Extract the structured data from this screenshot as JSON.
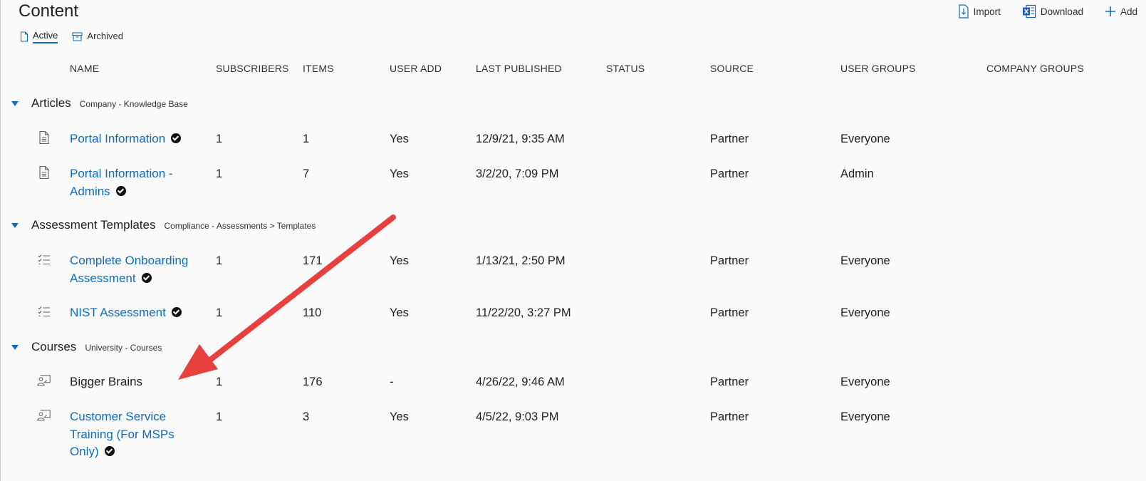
{
  "page": {
    "title": "Content",
    "tabs": [
      {
        "label": "Active",
        "icon": "document-icon",
        "active": true
      },
      {
        "label": "Archived",
        "icon": "archive-icon",
        "active": false
      }
    ],
    "toolbar": {
      "import_label": "Import",
      "download_label": "Download",
      "add_label": "Add"
    }
  },
  "columns": {
    "name": "NAME",
    "subscribers": "SUBSCRIBERS",
    "items": "ITEMS",
    "user_add": "USER ADD",
    "last_published": "LAST PUBLISHED",
    "status": "STATUS",
    "source": "SOURCE",
    "user_groups": "USER GROUPS",
    "company_groups": "COMPANY GROUPS"
  },
  "groups": [
    {
      "name": "Articles",
      "path": "Company - Knowledge Base",
      "rows": [
        {
          "icon": "document-icon",
          "name": "Portal Information",
          "link": true,
          "verified": true,
          "subscribers": "1",
          "items": "1",
          "user_add": "Yes",
          "last_published": "12/9/21, 9:35 AM",
          "source": "Partner",
          "user_groups": "Everyone"
        },
        {
          "icon": "document-icon",
          "name": "Portal Information - Admins",
          "link": true,
          "verified": true,
          "subscribers": "1",
          "items": "7",
          "user_add": "Yes",
          "last_published": "3/2/20, 7:09 PM",
          "source": "Partner",
          "user_groups": "Admin"
        }
      ]
    },
    {
      "name": "Assessment Templates",
      "path": "Compliance - Assessments > Templates",
      "rows": [
        {
          "icon": "checklist-icon",
          "name": "Complete Onboarding Assessment",
          "link": true,
          "verified": true,
          "subscribers": "1",
          "items": "171",
          "user_add": "Yes",
          "last_published": "1/13/21, 2:50 PM",
          "source": "Partner",
          "user_groups": "Everyone"
        },
        {
          "icon": "checklist-icon",
          "name": "NIST Assessment",
          "link": true,
          "verified": true,
          "subscribers": "1",
          "items": "110",
          "user_add": "Yes",
          "last_published": "11/22/20, 3:27 PM",
          "source": "Partner",
          "user_groups": "Everyone"
        }
      ]
    },
    {
      "name": "Courses",
      "path": "University - Courses",
      "rows": [
        {
          "icon": "course-icon",
          "name": "Bigger Brains",
          "link": false,
          "verified": false,
          "subscribers": "1",
          "items": "176",
          "user_add": "-",
          "last_published": "4/26/22, 9:46 AM",
          "source": "Partner",
          "user_groups": "Everyone"
        },
        {
          "icon": "course-icon",
          "name": "Customer Service Training (For MSPs Only)",
          "link": true,
          "verified": true,
          "subscribers": "1",
          "items": "3",
          "user_add": "Yes",
          "last_published": "4/5/22, 9:03 PM",
          "source": "Partner",
          "user_groups": "Everyone"
        }
      ]
    }
  ],
  "annotation": {
    "color": "#e8403f"
  },
  "colors": {
    "accent": "#0f6cbd",
    "background": "#fafafa"
  }
}
